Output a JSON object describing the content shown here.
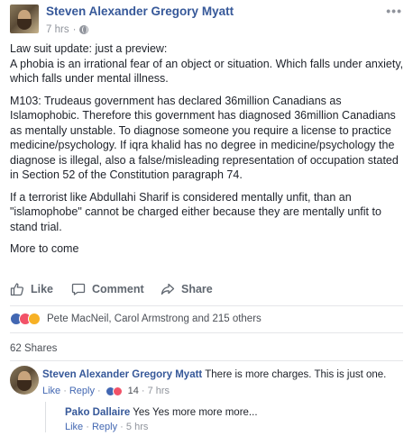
{
  "post": {
    "author": "Steven Alexander Gregory Myatt",
    "time": "7 hrs",
    "separator": "·",
    "more": "•••",
    "paragraphs": [
      "Law suit update: just a preview:\nA phobia is an irrational fear of an object or situation. Which falls under anxiety, which falls under mental illness.",
      "M103: Trudeaus government has declared 36million Canadians as Islamophobic. Therefore this government has diagnosed 36million Canadians as mentally unstable. To diagnose someone you require a license to practice medicine/psychology. If iqra khalid has no degree in medicine/psychology the diagnose is illegal, also a false/misleading representation of occupation stated in Section 52 of the Constitution paragraph 74.",
      "If a terrorist like Abdullahi Sharif is considered mentally unfit, than an \"islamophobe\" cannot be charged either because they are mentally unfit to stand trial.",
      "More to come"
    ]
  },
  "actions": {
    "like": "Like",
    "comment": "Comment",
    "share": "Share"
  },
  "reactions": {
    "names": "Pete MacNeil, Carol Armstrong and 215 others",
    "types": [
      "like",
      "love",
      "wow"
    ]
  },
  "shares": "62 Shares",
  "comment": {
    "author": "Steven Alexander Gregory Myatt",
    "text": "There is more charges. This is just one.",
    "like": "Like",
    "reply": "Reply",
    "dot": "·",
    "reaction_count": "14",
    "time": "7 hrs"
  },
  "reply": {
    "author": "Pako Dallaire",
    "text": "Yes Yes more more more...",
    "like": "Like",
    "reply": "Reply",
    "dot": "·",
    "time": "5 hrs"
  },
  "colors": {
    "link": "#365899",
    "meta": "#90949c",
    "action": "#606770",
    "like": "#4267b2",
    "love": "#f25268",
    "wow": "#f7b125"
  }
}
